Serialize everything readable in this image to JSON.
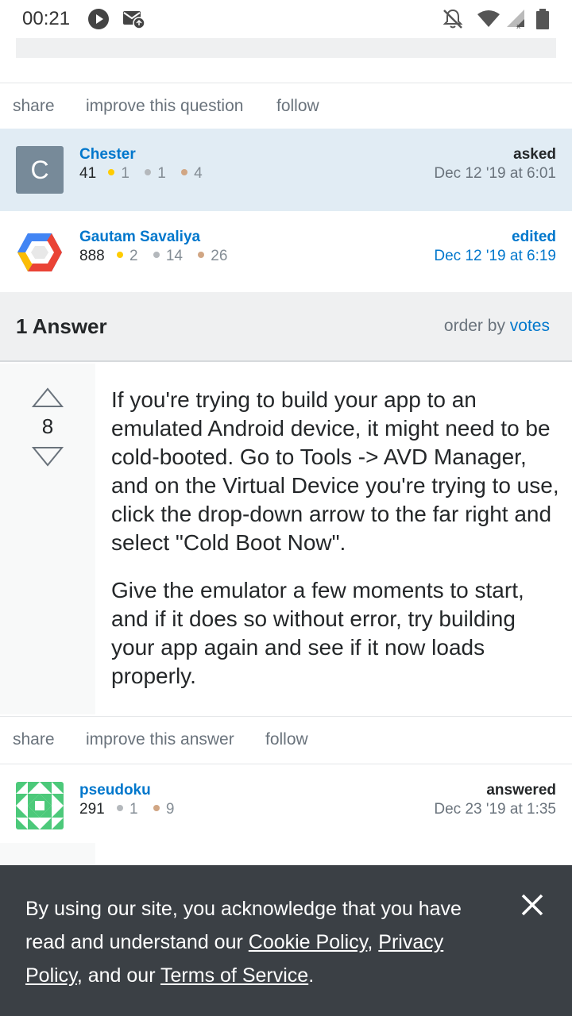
{
  "status_bar": {
    "time": "00:21",
    "icons": [
      "play-icon",
      "mail-icon",
      "notifications-off-icon",
      "wifi-icon",
      "signal-icon",
      "battery-icon"
    ]
  },
  "question_menu": {
    "share": "share",
    "improve": "improve this question",
    "follow": "follow"
  },
  "asked_card": {
    "avatar_letter": "C",
    "name": "Chester",
    "reputation": "41",
    "gold": "1",
    "silver": "1",
    "bronze": "4",
    "action": "asked",
    "time": "Dec 12 '19 at 6:01"
  },
  "edited_card": {
    "name": "Gautam Savaliya",
    "reputation": "888",
    "gold": "2",
    "silver": "14",
    "bronze": "26",
    "action": "edited",
    "time": "Dec 12 '19 at 6:19"
  },
  "answers_header": {
    "count": "1 Answer",
    "order_by_label": "order by",
    "order_by_value": "votes"
  },
  "answer": {
    "votes": "8",
    "paragraph1": "If you're trying to build your app to an emulated Android device, it might need to be cold-booted. Go to Tools -> AVD Manager, and on the Virtual Device you're trying to use, click the drop-down arrow to the far right and select \"Cold Boot Now\".",
    "paragraph2": "Give the emulator a few moments to start, and if it does so without error, try building your app again and see if it now loads properly."
  },
  "answer_menu": {
    "share": "share",
    "improve": "improve this answer",
    "follow": "follow"
  },
  "answered_card": {
    "name": "pseudoku",
    "reputation": "291",
    "silver": "1",
    "bronze": "9",
    "action": "answered",
    "time": "Dec 23 '19 at 1:35"
  },
  "cookie_banner": {
    "text_start": "By using our site, you acknowledge that you have read and understand our ",
    "cookie_policy": "Cookie Policy",
    "comma": ", ",
    "privacy_policy": "Privacy Policy",
    "and_our": ", and our ",
    "terms": "Terms of Service",
    "period": "."
  },
  "colors": {
    "link": "#0077cc",
    "asked_bg": "#e1ecf4",
    "banner_bg": "#3b4045",
    "gold": "#ffcc01",
    "silver": "#b4b8bc",
    "bronze": "#d1a684"
  }
}
